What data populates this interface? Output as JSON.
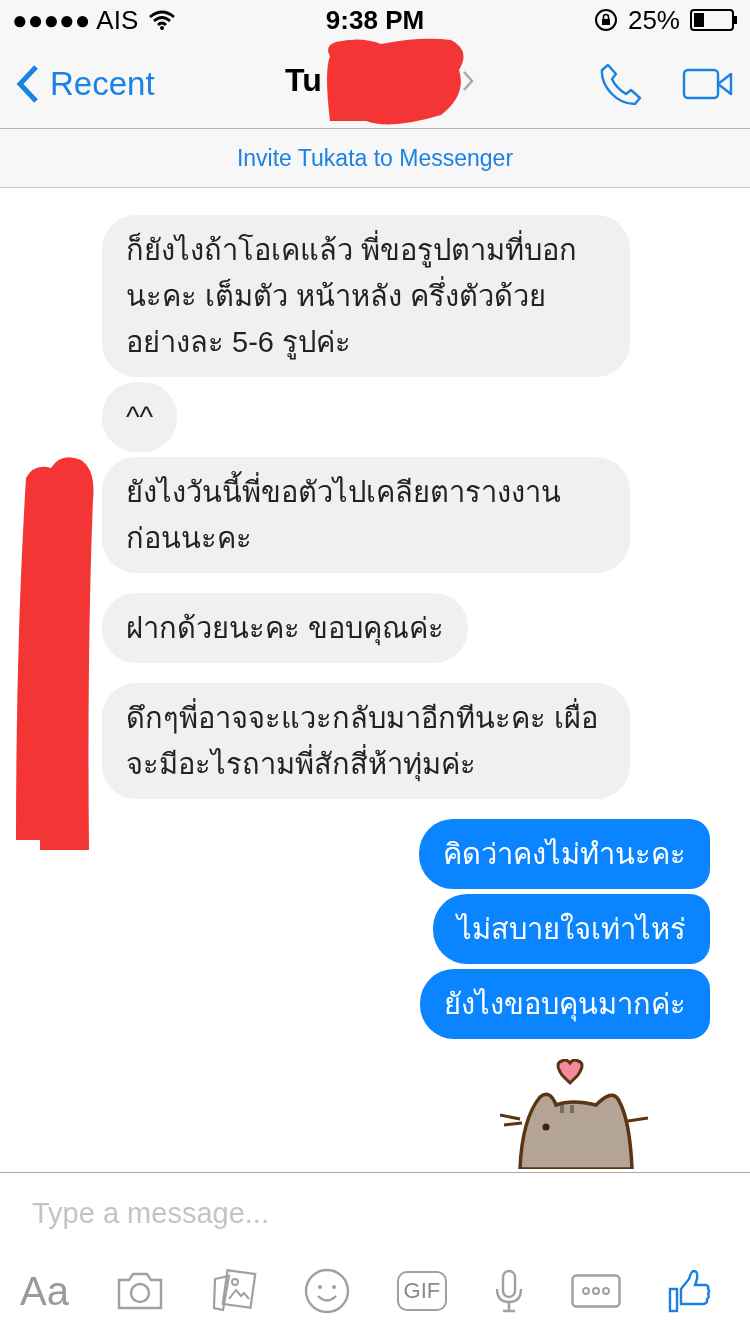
{
  "status_bar": {
    "carrier": "●●●●● AIS",
    "time": "9:38 PM",
    "battery_percent": "25%"
  },
  "nav": {
    "back_label": "Recent",
    "title": "Tu"
  },
  "banner": {
    "text": "Invite Tukata to Messenger"
  },
  "message_groups": [
    {
      "kind": "incoming",
      "messages": [
        "ก็ยังไงถ้าโอเคแล้ว พี่ขอรูปตามที่บอกนะคะ เต็มตัว หน้าหลัง ครึ่งตัวด้วย อย่างละ 5-6 รูปค่ะ",
        "^^",
        "ยังไงวันนี้พี่ขอตัวไปเคลียตารางงานก่อนนะคะ"
      ]
    },
    {
      "kind": "incoming",
      "messages": [
        "ฝากด้วยนะคะ ขอบคุณค่ะ"
      ]
    },
    {
      "kind": "incoming",
      "messages": [
        "ดึกๆพี่อาจจะแวะกลับมาอีกทีนะคะ เผื่อจะมีอะไรถามพี่สักสี่ห้าทุ่มค่ะ"
      ]
    },
    {
      "kind": "outgoing",
      "messages": [
        "คิดว่าคงไม่ทำนะคะ",
        "ไม่สบายใจเท่าไหร่",
        "ยังไงขอบคุนมากค่ะ"
      ]
    }
  ],
  "composer": {
    "placeholder": "Type a message...",
    "tools": [
      {
        "kind": "text",
        "label": "Aa"
      },
      {
        "kind": "camera"
      },
      {
        "kind": "photos"
      },
      {
        "kind": "emoji"
      },
      {
        "kind": "gif",
        "label": "GIF"
      },
      {
        "kind": "mic"
      },
      {
        "kind": "more"
      },
      {
        "kind": "like"
      }
    ]
  }
}
